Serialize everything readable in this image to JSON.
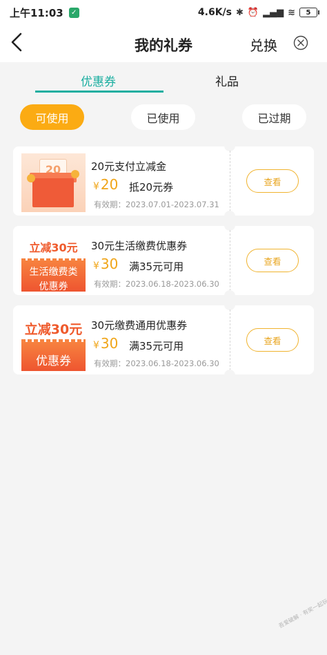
{
  "status_bar": {
    "time": "上午11:03",
    "network_speed": "4.6K/s",
    "battery": "5",
    "icons": [
      "shield-icon",
      "bluetooth-icon",
      "alarm-icon",
      "signal-icon",
      "wifi-icon",
      "battery-icon"
    ]
  },
  "header": {
    "title": "我的礼券",
    "exchange_label": "兑换",
    "back_icon": "chevron-left-icon",
    "close_icon": "close-circle-icon"
  },
  "tabs": [
    {
      "label": "优惠券",
      "active": true
    },
    {
      "label": "礼品",
      "active": false
    }
  ],
  "filters": [
    {
      "label": "可使用",
      "active": true
    },
    {
      "label": "已使用",
      "active": false
    },
    {
      "label": "已过期",
      "active": false
    }
  ],
  "coupons": [
    {
      "name": "20元支付立减金",
      "currency": "¥",
      "amount": "20",
      "condition": "抵20元券",
      "validity": "有效期：2023.07.01-2023.07.31",
      "button": "查看",
      "thumb_text": "20"
    },
    {
      "name": "30元生活缴费优惠券",
      "currency": "¥",
      "amount": "30",
      "condition": "满35元可用",
      "validity": "有效期：2023.06.18-2023.06.30",
      "button": "查看",
      "thumb_top": "立减30元",
      "thumb_band_1": "生活缴费类",
      "thumb_band_2": "优惠券"
    },
    {
      "name": "30元缴费通用优惠券",
      "currency": "¥",
      "amount": "30",
      "condition": "满35元可用",
      "validity": "有效期：2023.06.18-2023.06.30",
      "button": "查看",
      "thumb_top": "立减30元",
      "thumb_band": "优惠券"
    }
  ],
  "colors": {
    "accent": "#1aaea0",
    "pill_active": "#fbab13",
    "price": "#f0a519",
    "button_border": "#f0b32e"
  },
  "watermark": "吾爱破解 · 有奖一起玩 · www.52pojie.cn"
}
